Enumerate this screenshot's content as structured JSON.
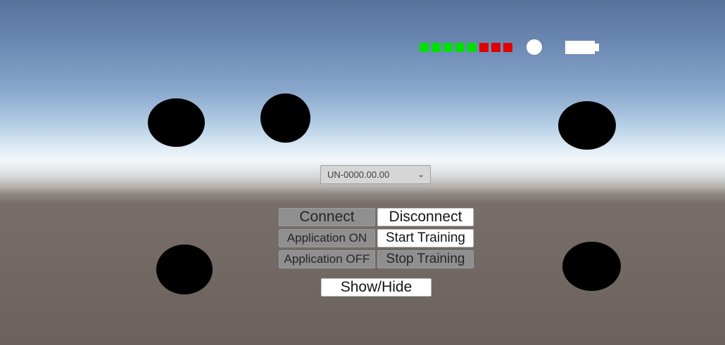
{
  "status": {
    "signal_leds": [
      "#00e000",
      "#00e000",
      "#00e000",
      "#00e000",
      "#00e000",
      "#e00000",
      "#e00000",
      "#e00000"
    ],
    "connection_indicator_color": "#ffffff",
    "battery_icon": "battery-full-icon"
  },
  "device_select": {
    "selected": "UN-0000.00.00"
  },
  "buttons": {
    "connect": "Connect",
    "disconnect": "Disconnect",
    "application_on": "Application ON",
    "start_training": "Start Training",
    "application_off": "Application OFF",
    "stop_training": "Stop Training",
    "show_hide": "Show/Hide"
  }
}
